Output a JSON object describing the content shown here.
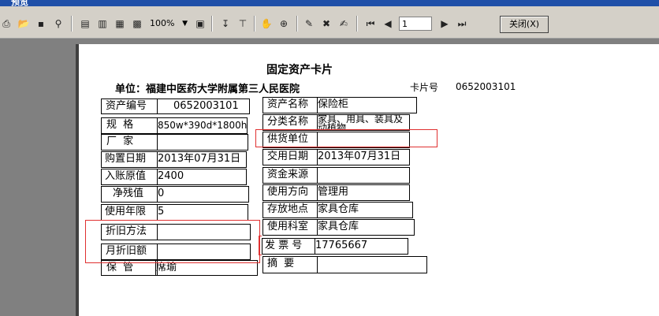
{
  "window": {
    "title": "预览"
  },
  "toolbar": {
    "zoom": "100%",
    "page": "1",
    "close_label": "关闭(X)"
  },
  "card": {
    "title": "固定资产卡片",
    "unit_label": "单位：",
    "unit_name": "福建中医药大学附属第三人民医院",
    "card_no_label": "卡片号",
    "card_no": "0652003101"
  },
  "left": {
    "asset_no_label": "资产编号",
    "asset_no": "0652003101",
    "spec_label": "规    格",
    "spec": "850w*390d*1800h",
    "maker_label": "厂    家",
    "maker": "",
    "purchase_date_label": "购置日期",
    "purchase_date": "2013年07月31日",
    "original_value_label": "入账原值",
    "original_value": "2400",
    "residual_label": "净残值",
    "residual": "0",
    "life_label": "使用年限",
    "life": "5",
    "dep_method_label": "折旧方法",
    "dep_method": "",
    "monthly_dep_label": "月折旧额",
    "monthly_dep": "",
    "keeper_label": "保    管",
    "keeper": "席瑜"
  },
  "right": {
    "name_label": "资产名称",
    "name": "保险柜",
    "category_label": "分类名称",
    "category": "家具、用具、装具及动植物",
    "supplier_label": "供货单位",
    "supplier": "",
    "use_date_label": "交用日期",
    "use_date": "2013年07月31日",
    "fund_label": "资金来源",
    "fund": "",
    "direction_label": "使用方向",
    "direction": "管理用",
    "location_label": "存放地点",
    "location": "家具仓库",
    "dept_label": "使用科室",
    "dept": "家具仓库",
    "invoice_label": "发 票 号",
    "invoice": "17765667",
    "summary_label": "摘    要",
    "summary": ""
  }
}
